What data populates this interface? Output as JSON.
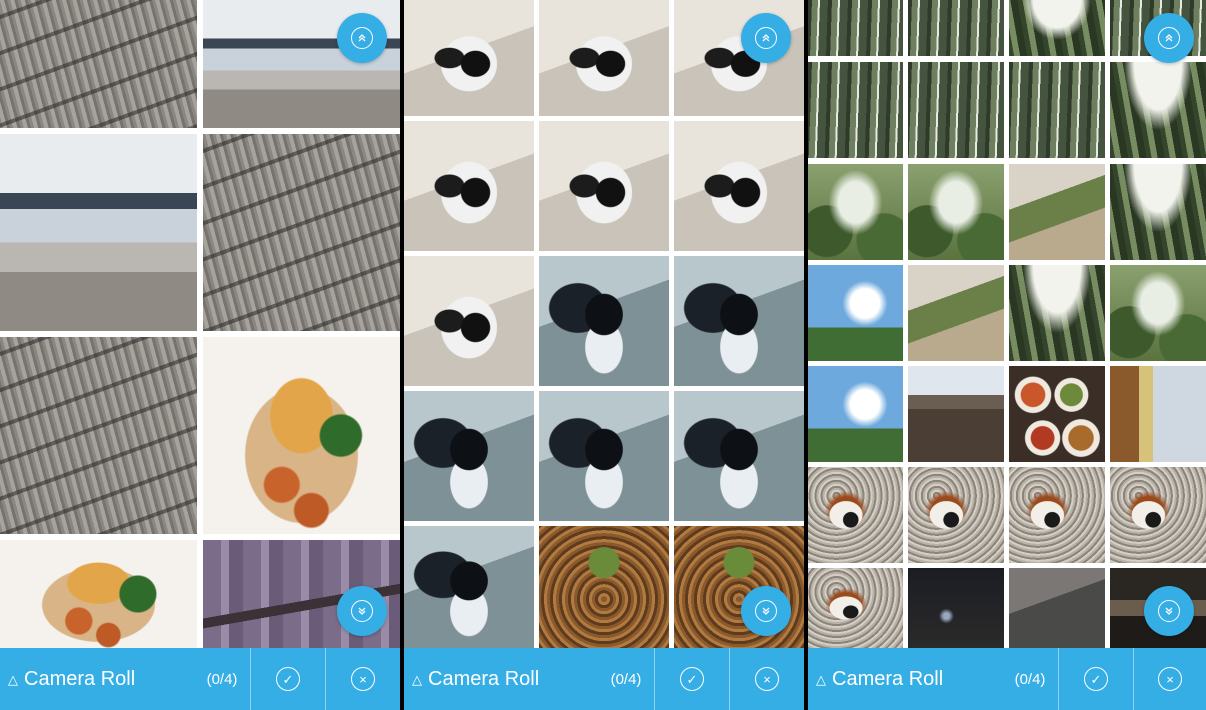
{
  "colors": {
    "accent": "#35aee6",
    "bar_text": "#ffffff"
  },
  "panels": [
    {
      "album_title": "Camera Roll",
      "album_toggle_icon": "triangle-up-icon",
      "selection_count": "(0/4)",
      "confirm_icon": "check-icon",
      "cancel_icon": "close-icon",
      "scroll_top_icon": "scroll-to-top-icon",
      "scroll_bottom_icon": "scroll-to-bottom-icon"
    },
    {
      "album_title": "Camera Roll",
      "album_toggle_icon": "triangle-up-icon",
      "selection_count": "(0/4)",
      "confirm_icon": "check-icon",
      "cancel_icon": "close-icon",
      "scroll_top_icon": "scroll-to-top-icon",
      "scroll_bottom_icon": "scroll-to-bottom-icon"
    },
    {
      "album_title": "Camera Roll",
      "album_toggle_icon": "triangle-up-icon",
      "selection_count": "(0/4)",
      "confirm_icon": "check-icon",
      "cancel_icon": "close-icon",
      "scroll_top_icon": "scroll-to-top-icon",
      "scroll_bottom_icon": "scroll-to-bottom-icon"
    }
  ],
  "glyphs": {
    "triangle": "△",
    "check": "✓",
    "close": "×"
  }
}
